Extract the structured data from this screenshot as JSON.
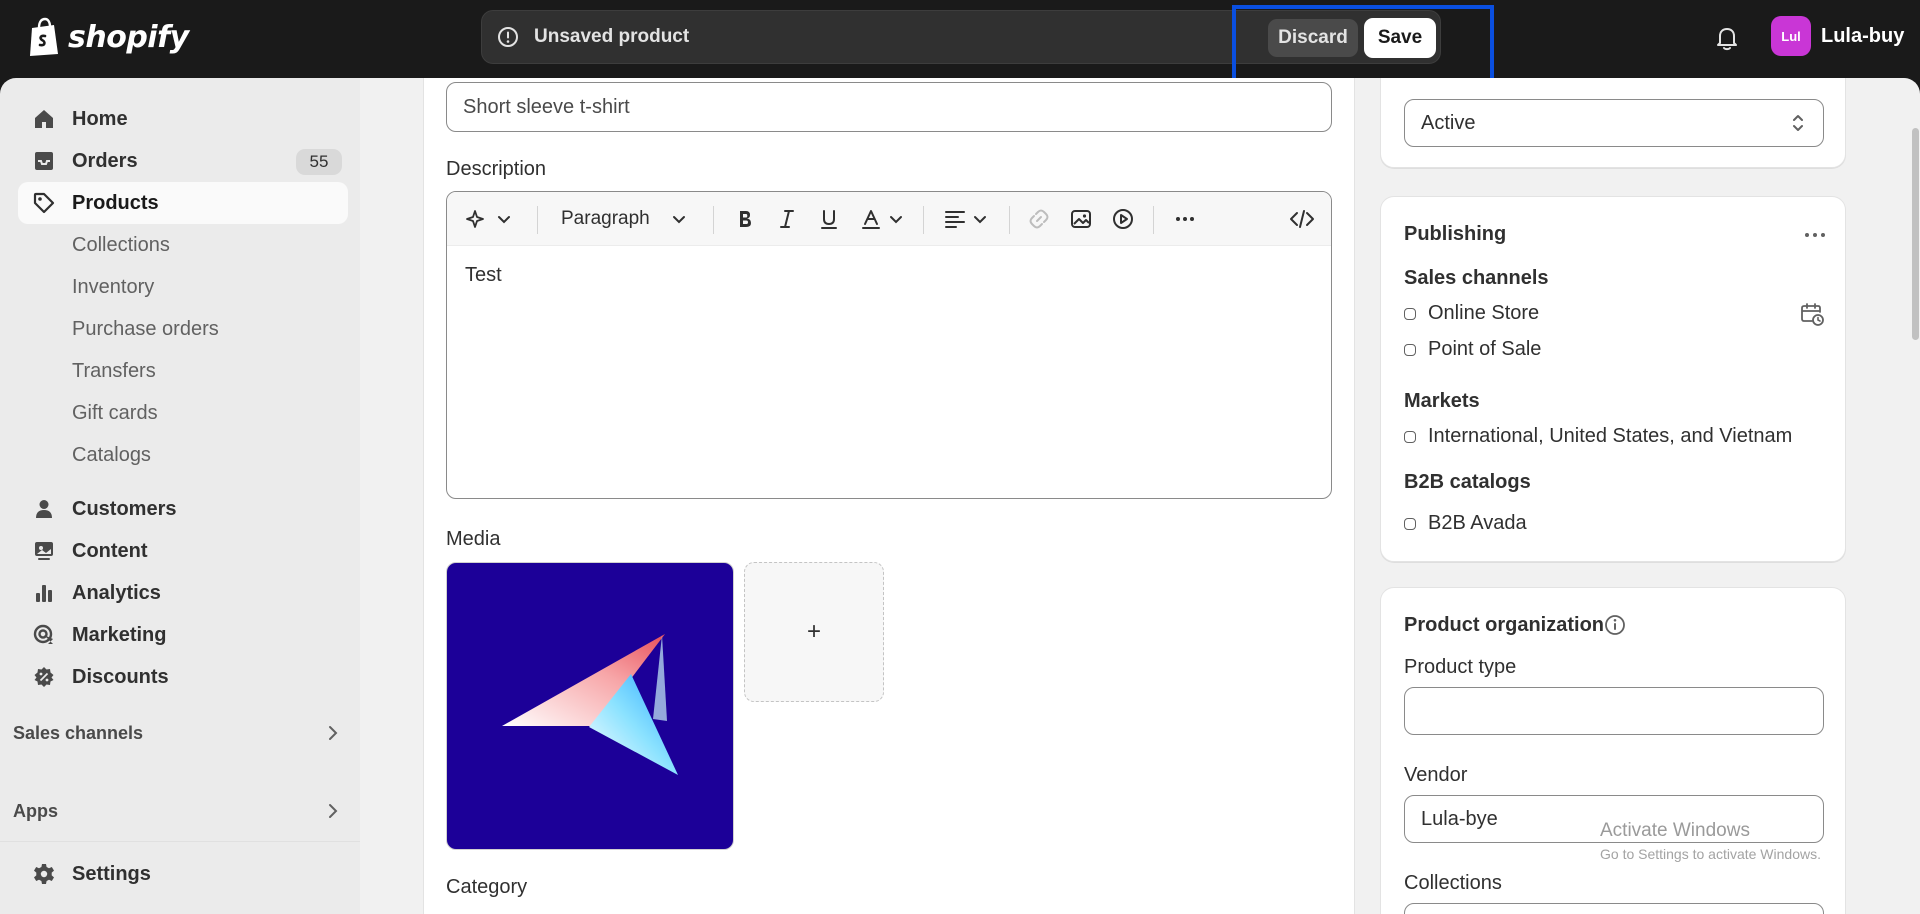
{
  "topbar": {
    "brand": "shopify",
    "unsaved_title": "Unsaved product",
    "discard_label": "Discard",
    "save_label": "Save",
    "avatar_initials": "Lul",
    "account_name": "Lula-buy"
  },
  "sidebar": {
    "items": [
      {
        "label": "Home",
        "icon": "home-icon"
      },
      {
        "label": "Orders",
        "icon": "inbox-icon",
        "badge": "55"
      },
      {
        "label": "Products",
        "icon": "tag-icon"
      },
      {
        "label": "Collections"
      },
      {
        "label": "Inventory"
      },
      {
        "label": "Purchase orders"
      },
      {
        "label": "Transfers"
      },
      {
        "label": "Gift cards"
      },
      {
        "label": "Catalogs"
      },
      {
        "label": "Customers",
        "icon": "person-icon"
      },
      {
        "label": "Content",
        "icon": "content-icon"
      },
      {
        "label": "Analytics",
        "icon": "bar-chart-icon"
      },
      {
        "label": "Marketing",
        "icon": "target-icon"
      },
      {
        "label": "Discounts",
        "icon": "discount-icon"
      }
    ],
    "sales_channels_label": "Sales channels",
    "apps_label": "Apps",
    "settings_label": "Settings"
  },
  "main": {
    "title_value": "Short sleeve t-shirt",
    "description_label": "Description",
    "editor_format": "Paragraph",
    "editor_content": "Test",
    "media_label": "Media",
    "media_add": "+",
    "category_label": "Category"
  },
  "status": {
    "value": "Active"
  },
  "publishing": {
    "title": "Publishing",
    "sales_channels_label": "Sales channels",
    "channels": [
      "Online Store",
      "Point of Sale"
    ],
    "markets_label": "Markets",
    "markets": "International, United States, and Vietnam",
    "b2b_label": "B2B catalogs",
    "b2b": "B2B Avada"
  },
  "organization": {
    "title": "Product organization",
    "product_type_label": "Product type",
    "product_type_value": "",
    "vendor_label": "Vendor",
    "vendor_value": "Lula-bye",
    "collections_label": "Collections"
  },
  "watermark": {
    "line1": "Activate Windows",
    "line2": "Go to Settings to activate Windows."
  },
  "colors": {
    "topbar": "#1a1a1a",
    "highlight": "#0a4fe0",
    "media_bg": "#1c0098",
    "avatar": "#c936d6"
  }
}
